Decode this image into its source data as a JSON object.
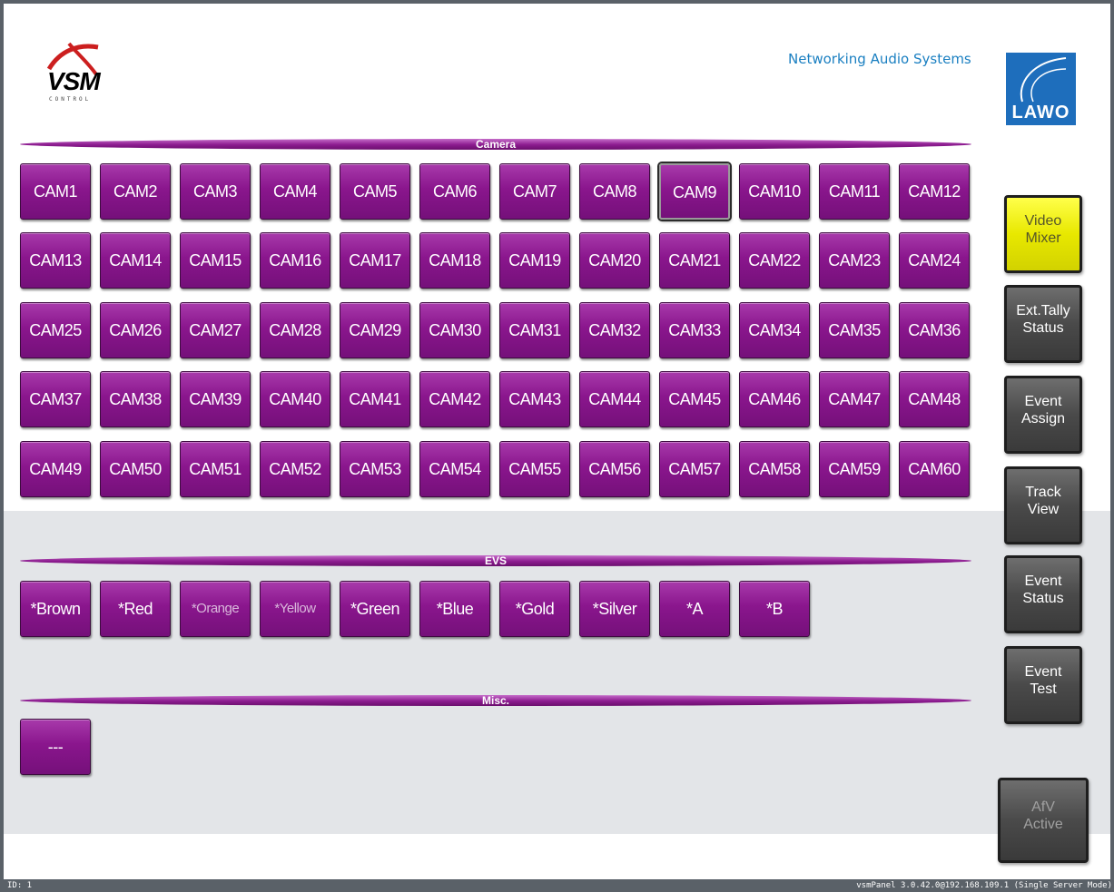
{
  "header": {
    "vsm_logo_text": "VSM",
    "vsm_logo_sub": "CONTROL",
    "tagline": "Networking Audio Systems",
    "lawo_text": "LAWO"
  },
  "sections": {
    "camera": "Camera",
    "evs": "EVS",
    "misc": "Misc."
  },
  "cameras": [
    "CAM1",
    "CAM2",
    "CAM3",
    "CAM4",
    "CAM5",
    "CAM6",
    "CAM7",
    "CAM8",
    "CAM9",
    "CAM10",
    "CAM11",
    "CAM12",
    "CAM13",
    "CAM14",
    "CAM15",
    "CAM16",
    "CAM17",
    "CAM18",
    "CAM19",
    "CAM20",
    "CAM21",
    "CAM22",
    "CAM23",
    "CAM24",
    "CAM25",
    "CAM26",
    "CAM27",
    "CAM28",
    "CAM29",
    "CAM30",
    "CAM31",
    "CAM32",
    "CAM33",
    "CAM34",
    "CAM35",
    "CAM36",
    "CAM37",
    "CAM38",
    "CAM39",
    "CAM40",
    "CAM41",
    "CAM42",
    "CAM43",
    "CAM44",
    "CAM45",
    "CAM46",
    "CAM47",
    "CAM48",
    "CAM49",
    "CAM50",
    "CAM51",
    "CAM52",
    "CAM53",
    "CAM54",
    "CAM55",
    "CAM56",
    "CAM57",
    "CAM58",
    "CAM59",
    "CAM60"
  ],
  "selected_camera": "CAM9",
  "evs": [
    {
      "label": "*Brown",
      "dim": false
    },
    {
      "label": "*Red",
      "dim": false
    },
    {
      "label": "*Orange",
      "dim": true
    },
    {
      "label": "*Yellow",
      "dim": true
    },
    {
      "label": "*Green",
      "dim": false
    },
    {
      "label": "*Blue",
      "dim": false
    },
    {
      "label": "*Gold",
      "dim": false
    },
    {
      "label": "*Silver",
      "dim": false
    },
    {
      "label": "*A",
      "dim": false
    },
    {
      "label": "*B",
      "dim": false
    }
  ],
  "misc": [
    "---"
  ],
  "side_buttons": [
    {
      "label": "Video\nMixer",
      "style": "yellow"
    },
    {
      "label": "Ext.Tally\nStatus",
      "style": "gray"
    },
    {
      "label": "Event\nAssign",
      "style": "gray"
    },
    {
      "label": "Track\nView",
      "style": "gray"
    },
    {
      "label": "Event\nStatus",
      "style": "gray"
    },
    {
      "label": "Event\nTest",
      "style": "gray"
    }
  ],
  "afv_button": {
    "label": "AfV\nActive"
  },
  "status": {
    "left": "ID: 1",
    "right": "vsmPanel 3.0.42.0@192.168.109.1 (Single Server Mode)"
  },
  "colors": {
    "button_purple": "#8a168d",
    "video_mixer_yellow": "#e8e800",
    "tagline_blue": "#1a7fc1",
    "lawo_blue": "#1e6ebc"
  }
}
